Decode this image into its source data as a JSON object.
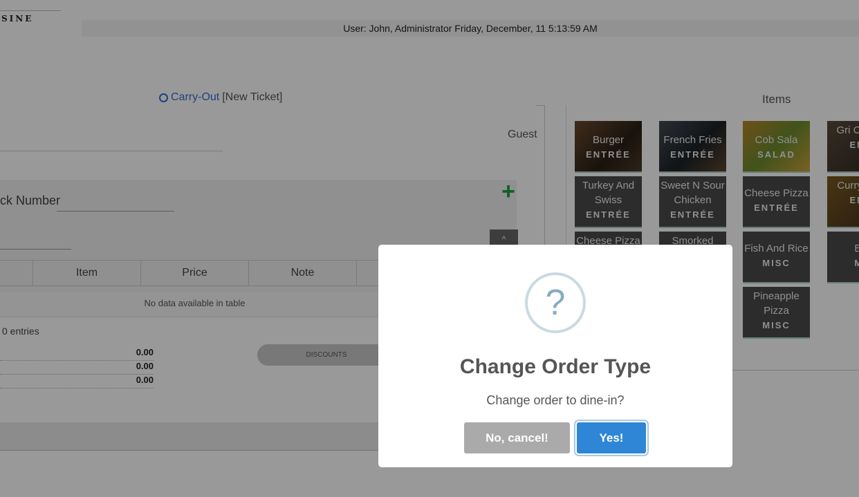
{
  "header": {
    "logo_text": "SINE",
    "user_info": "User: John, Administrator Friday, December, 11 5:13:59 AM"
  },
  "order": {
    "type_label": "Carry-Out",
    "ticket_label": "[New Ticket]",
    "guest_label": "Guest",
    "track_label": "ck Number",
    "add_icon": "plus-icon",
    "sort_glyph": "^"
  },
  "table": {
    "columns": [
      "Item",
      "Price",
      "Note"
    ],
    "empty_text": "No data available in table",
    "entries_text": "0 entries"
  },
  "totals": [
    "0.00",
    "0.00",
    "0.00"
  ],
  "discounts_label": "DISCOUNTS",
  "items": {
    "title": "Items",
    "tiles": [
      {
        "name": "Burger",
        "category": "ENTRÉE"
      },
      {
        "name": "French Fries",
        "category": "ENTRÉE"
      },
      {
        "name": "Cob Sala",
        "category": "SALAD"
      },
      {
        "name": "Gri Chicke",
        "category": "ENT"
      },
      {
        "name": "Turkey And Swiss",
        "category": "ENTRÉE"
      },
      {
        "name": "Sweet N Sour Chicken",
        "category": "ENTRÉE"
      },
      {
        "name": "Cheese Pizza",
        "category": "ENTRÉE"
      },
      {
        "name": "Curry C Fi",
        "category": "ENT"
      },
      {
        "name": "Cheese Pizza",
        "category": ""
      },
      {
        "name": "Smorked",
        "category": ""
      },
      {
        "name": "Fish And Rice",
        "category": "MISC"
      },
      {
        "name": "Be",
        "category": "MI"
      },
      {
        "name": "Pineapple Pizza",
        "category": "MISC"
      }
    ]
  },
  "modal": {
    "icon_glyph": "?",
    "title": "Change Order Type",
    "text": "Change order to dine-in?",
    "cancel_label": "No, cancel!",
    "confirm_label": "Yes!"
  }
}
